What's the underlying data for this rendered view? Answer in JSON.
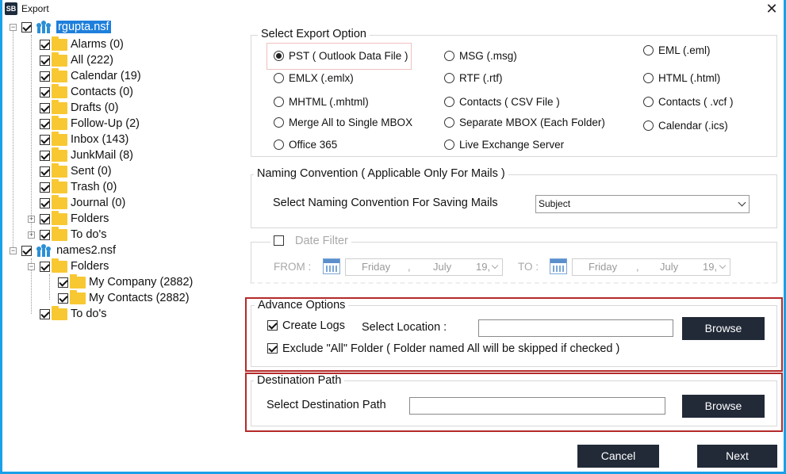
{
  "window": {
    "app_icon": "SB",
    "title": "Export",
    "close_glyph": "✕"
  },
  "tree": {
    "root1": {
      "label": "rgupta.nsf",
      "checked": true
    },
    "root1_items": [
      {
        "label": "Alarms (0)"
      },
      {
        "label": "All (222)"
      },
      {
        "label": "Calendar (19)"
      },
      {
        "label": "Contacts (0)"
      },
      {
        "label": "Drafts (0)"
      },
      {
        "label": "Follow-Up (2)"
      },
      {
        "label": "Inbox (143)"
      },
      {
        "label": "JunkMail (8)"
      },
      {
        "label": "Sent (0)"
      },
      {
        "label": "Trash (0)"
      },
      {
        "label": "Journal (0)"
      },
      {
        "label": "Folders"
      },
      {
        "label": "To do's"
      }
    ],
    "root2": {
      "label": "names2.nsf"
    },
    "root2_items": [
      {
        "label": "Folders"
      },
      {
        "label": "My Company (2882)"
      },
      {
        "label": "My Contacts (2882)"
      },
      {
        "label": "To do's"
      }
    ]
  },
  "export_options": {
    "title": "Select Export Option",
    "options": [
      {
        "label": "PST ( Outlook Data File )",
        "selected": true
      },
      {
        "label": "MSG (.msg)"
      },
      {
        "label": "EML (.eml)"
      },
      {
        "label": "EMLX (.emlx)"
      },
      {
        "label": "RTF (.rtf)"
      },
      {
        "label": "HTML (.html)"
      },
      {
        "label": "MHTML (.mhtml)"
      },
      {
        "label": "Contacts ( CSV File )"
      },
      {
        "label": "Contacts ( .vcf )"
      },
      {
        "label": "Merge All to Single MBOX"
      },
      {
        "label": "Separate MBOX (Each Folder)"
      },
      {
        "label": "Calendar (.ics)"
      },
      {
        "label": "Office 365"
      },
      {
        "label": "Live Exchange Server"
      }
    ]
  },
  "naming": {
    "title": "Naming Convention ( Applicable Only For Mails )",
    "label": "Select Naming Convention For Saving Mails",
    "value": "Subject"
  },
  "date_filter": {
    "label": "Date Filter",
    "from_label": "FROM :",
    "to_label": "TO :",
    "from": {
      "day": "Friday",
      "sep": ",",
      "month": "July",
      "date": "19,"
    },
    "to": {
      "day": "Friday",
      "sep": ",",
      "month": "July",
      "date": "19,"
    }
  },
  "advance": {
    "title": "Advance Options",
    "create_logs": "Create Logs",
    "select_location": "Select Location :",
    "browse": "Browse",
    "exclude_all": "Exclude \"All\" Folder ( Folder named All will be skipped if checked )"
  },
  "destination": {
    "title": "Destination Path",
    "label": "Select Destination Path",
    "browse": "Browse"
  },
  "footer": {
    "cancel": "Cancel",
    "next": "Next"
  },
  "colors": {
    "accent": "#18a0e8",
    "selection": "#1e7fdc",
    "highlight_border": "#b52a2a",
    "button": "#222a38",
    "folder": "#f8c833"
  }
}
